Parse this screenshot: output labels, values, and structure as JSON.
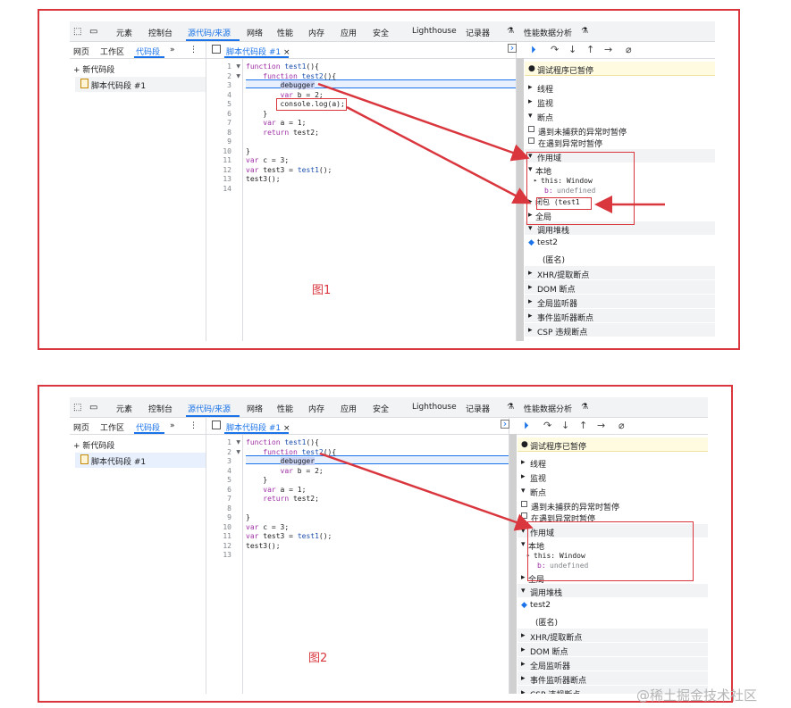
{
  "colors": {
    "accent": "#1a73e8",
    "annotation": "#d9363e",
    "paused_bg": "#fffbe0"
  },
  "devtools": {
    "top_tabs": [
      "元素",
      "控制台",
      "源代码/来源",
      "网络",
      "性能",
      "内存",
      "应用",
      "安全",
      "Lighthouse",
      "记录器",
      "性能数据分析"
    ],
    "active_top_tab": "源代码/来源",
    "sub_tabs": [
      "网页",
      "工作区",
      "代码段"
    ],
    "sub_more": "»",
    "new_snippet": "+ 新代码段",
    "snippet_name": "脚本代码段 #1",
    "editor_tab": "脚本代码段 #1",
    "editor_tab_close": "×",
    "debug_paused": "调试程序已暂停",
    "threads": "线程",
    "watch": "监视",
    "breakpoints": "断点",
    "pause_uncaught": "遇到未捕获的异常时暂停",
    "pause_caught": "在遇到异常时暂停",
    "scope": "作用域",
    "local": "本地",
    "this_label": "this: Window",
    "b_label": "b:",
    "b_value": "undefined",
    "closure": "闭包 (test1",
    "global": "全局",
    "call_stack": "调用堆栈",
    "frame_test2": "test2",
    "frame_anon": "(匿名)",
    "xhr": "XHR/提取断点",
    "dom": "DOM 断点",
    "global_listeners": "全局监听器",
    "event_listener_bp": "事件监听器断点",
    "csp": "CSP 违规断点"
  },
  "code1": [
    "function test1(){",
    "    function test2(){",
    "        debugger",
    "        var b = 2;",
    "        console.log(a);",
    "    }",
    "    var a = 1;",
    "    return test2;",
    "",
    "}",
    "var c = 3;",
    "var test3 = test1();",
    "test3();",
    ""
  ],
  "code2": [
    "function test1(){",
    "    function test2(){",
    "        debugger",
    "        var b = 2;",
    "    }",
    "    var a = 1;",
    "    return test2;",
    "",
    "}",
    "var c = 3;",
    "var test3 = test1();",
    "test3();",
    ""
  ],
  "fig1_label": "图1",
  "fig2_label": "图2",
  "watermark": "@稀土掘金技术社区"
}
